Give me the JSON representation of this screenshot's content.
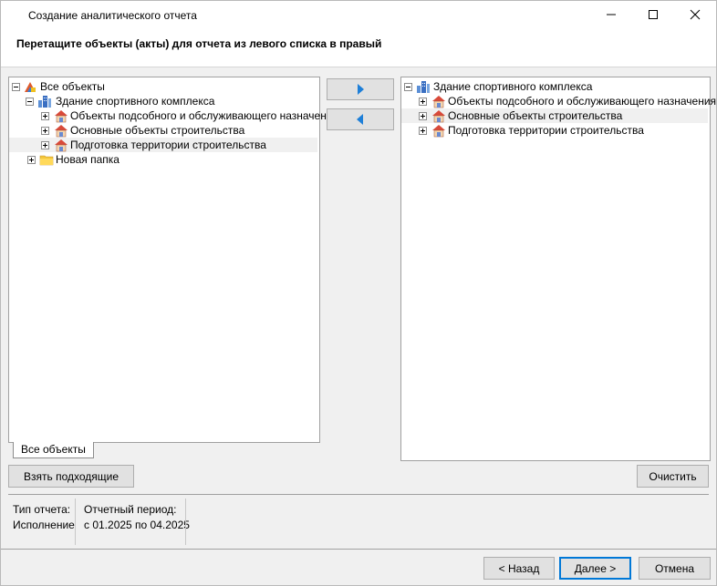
{
  "window": {
    "title": "Создание аналитического отчета"
  },
  "header": {
    "instruction": "Перетащите объекты (акты) для отчета из левого списка в правый"
  },
  "left_tree": {
    "root": "Все объекты",
    "building": "Здание спортивного комплекса",
    "items": [
      "Объекты подсобного и обслуживающего назначения",
      "Основные объекты строительства",
      "Подготовка территории строительства"
    ],
    "folder": "Новая папка"
  },
  "right_tree": {
    "building": "Здание спортивного комплекса",
    "items": [
      "Объекты подсобного и обслуживающего назначения",
      "Основные объекты строительства",
      "Подготовка территории строительства"
    ]
  },
  "tab": {
    "label": "Все объекты"
  },
  "buttons": {
    "take_matching": "Взять подходящие",
    "clear": "Очистить",
    "back": "< Назад",
    "next": "Далее >",
    "cancel": "Отмена"
  },
  "info": {
    "report_type_label": "Тип отчета:",
    "report_type_value": "Исполнение",
    "period_label": "Отчетный период:",
    "period_value": "с 01.2025 по 04.2025"
  },
  "colors": {
    "accent": "#0078d7",
    "move_arrow": "#1e7fd8"
  },
  "icons": {
    "root": "all-objects-icon",
    "building": "building-icon",
    "item": "construction-object-icon",
    "folder": "folder-icon"
  }
}
